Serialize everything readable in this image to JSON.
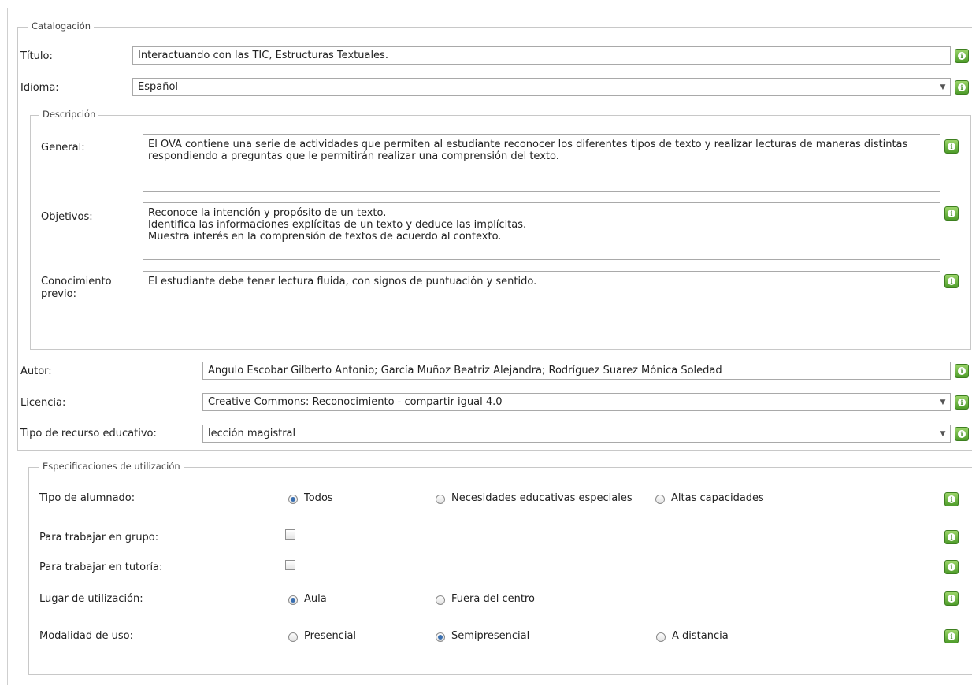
{
  "catalogacion": {
    "legend": "Catalogación",
    "titulo": {
      "label": "Título:",
      "value": "Interactuando con las TIC, Estructuras Textuales."
    },
    "idioma": {
      "label": "Idioma:",
      "value": "Español"
    },
    "descripcion": {
      "legend": "Descripción",
      "general": {
        "label": "General:",
        "value": "El OVA contiene una serie de actividades que permiten al estudiante reconocer los diferentes tipos de texto y realizar lecturas de maneras distintas\nrespondiendo a preguntas que le permitirán realizar una comprensión del texto."
      },
      "objetivos": {
        "label": "Objetivos:",
        "value": "Reconoce la intención y propósito de un texto.\nIdentifica las informaciones explícitas de un texto y deduce las implícitas.\nMuestra interés en la comprensión de textos de acuerdo al contexto."
      },
      "conocimiento": {
        "label": "Conocimiento previo:",
        "value": "El estudiante debe tener lectura fluida, con signos de puntuación y sentido."
      }
    },
    "autor": {
      "label": "Autor:",
      "value": "Angulo Escobar Gilberto Antonio; García Muñoz Beatriz Alejandra; Rodríguez Suarez Mónica Soledad"
    },
    "licencia": {
      "label": "Licencia:",
      "value": "Creative Commons: Reconocimiento - compartir igual 4.0"
    },
    "tipo_recurso": {
      "label": "Tipo de recurso educativo:",
      "value": "lección magistral"
    }
  },
  "especificaciones": {
    "legend": "Especificaciones de utilización",
    "tipo_alumnado": {
      "label": "Tipo de alumnado:",
      "options": [
        "Todos",
        "Necesidades educativas especiales",
        "Altas capacidades"
      ],
      "selected": "Todos"
    },
    "trabajar_grupo": {
      "label": "Para trabajar en grupo:",
      "checked": false
    },
    "trabajar_tutoria": {
      "label": "Para trabajar en tutoría:",
      "checked": false
    },
    "lugar": {
      "label": "Lugar de utilización:",
      "options": [
        "Aula",
        "Fuera del centro"
      ],
      "selected": "Aula"
    },
    "modalidad": {
      "label": "Modalidad de uso:",
      "options": [
        "Presencial",
        "Semipresencial",
        "A distancia"
      ],
      "selected": "Semipresencial"
    }
  },
  "icons": {
    "info": "info-icon",
    "dropdown": "chevron-down-icon",
    "accent_green": "#4e9c2a",
    "radio_dot": "#3a6fb0"
  }
}
